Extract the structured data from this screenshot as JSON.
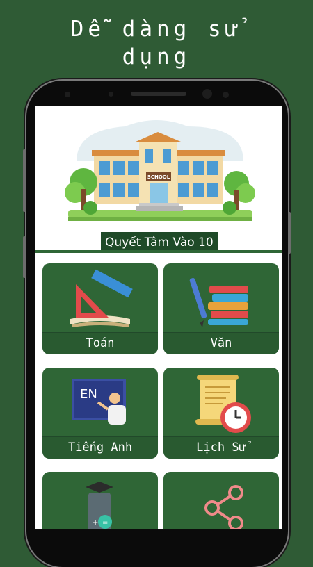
{
  "promo": {
    "title_line1": "Dễ dàng sử",
    "title_line2": "dụng"
  },
  "banner": {
    "school_sign": "SCHOOL",
    "caption": "Quyết Tâm Vào 10"
  },
  "subjects": [
    {
      "label": "Toán",
      "icon": "geometry-tools-icon"
    },
    {
      "label": "Văn",
      "icon": "books-pencil-icon"
    },
    {
      "label": "Tiếng Anh",
      "icon": "english-teacher-icon"
    },
    {
      "label": "Lịch Sử",
      "icon": "history-scroll-clock-icon"
    },
    {
      "label": "",
      "icon": "calculator-grad-cap-icon"
    },
    {
      "label": "",
      "icon": "share-network-icon"
    }
  ],
  "colors": {
    "background": "#2f5b35",
    "tile": "#2f6636",
    "caption_bg": "#1f4a28"
  }
}
